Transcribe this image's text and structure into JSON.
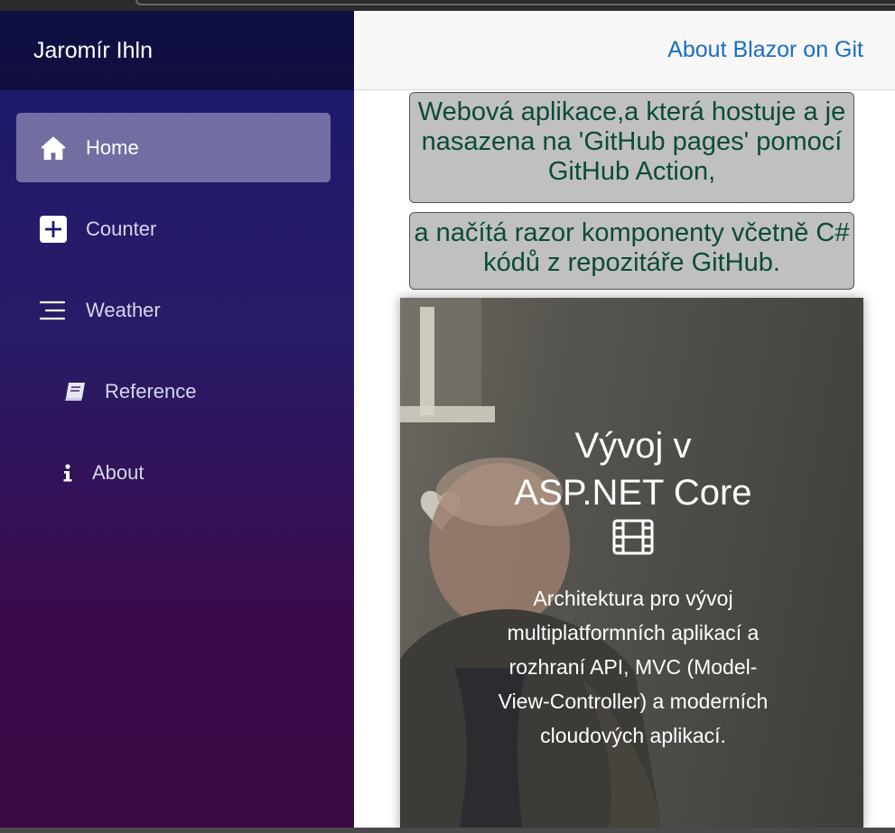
{
  "sidebar": {
    "brand": "Jaromír Ihln",
    "items": [
      {
        "label": "Home",
        "icon": "home-icon",
        "active": true
      },
      {
        "label": "Counter",
        "icon": "plus-square-icon"
      },
      {
        "label": "Weather",
        "icon": "list-icon"
      },
      {
        "label": "Reference",
        "icon": "book-icon"
      },
      {
        "label": "About",
        "icon": "info-icon"
      }
    ]
  },
  "topbar": {
    "link": "About Blazor on Git"
  },
  "banners": [
    "Webová aplikace,a která hostuje a je nasazena na 'GitHub pages' pomocí GitHub Action,",
    "a načítá razor komponenty včetně C# kódů z repozitáře GitHub."
  ],
  "card": {
    "title": "Vývoj v ASP.NET Core",
    "title_icon": "film-icon",
    "description": "Architektura pro vývoj multiplatformních aplikací a rozhraní API, MVC (Model-View-Controller) a moderních cloudových aplikací."
  },
  "colors": {
    "link": "#1b6ec2",
    "banner_text": "#0b4a3a",
    "banner_bg": "#c0c0c0",
    "sidebar_top": "#1b1a6e",
    "sidebar_bottom": "#3a0a45"
  }
}
